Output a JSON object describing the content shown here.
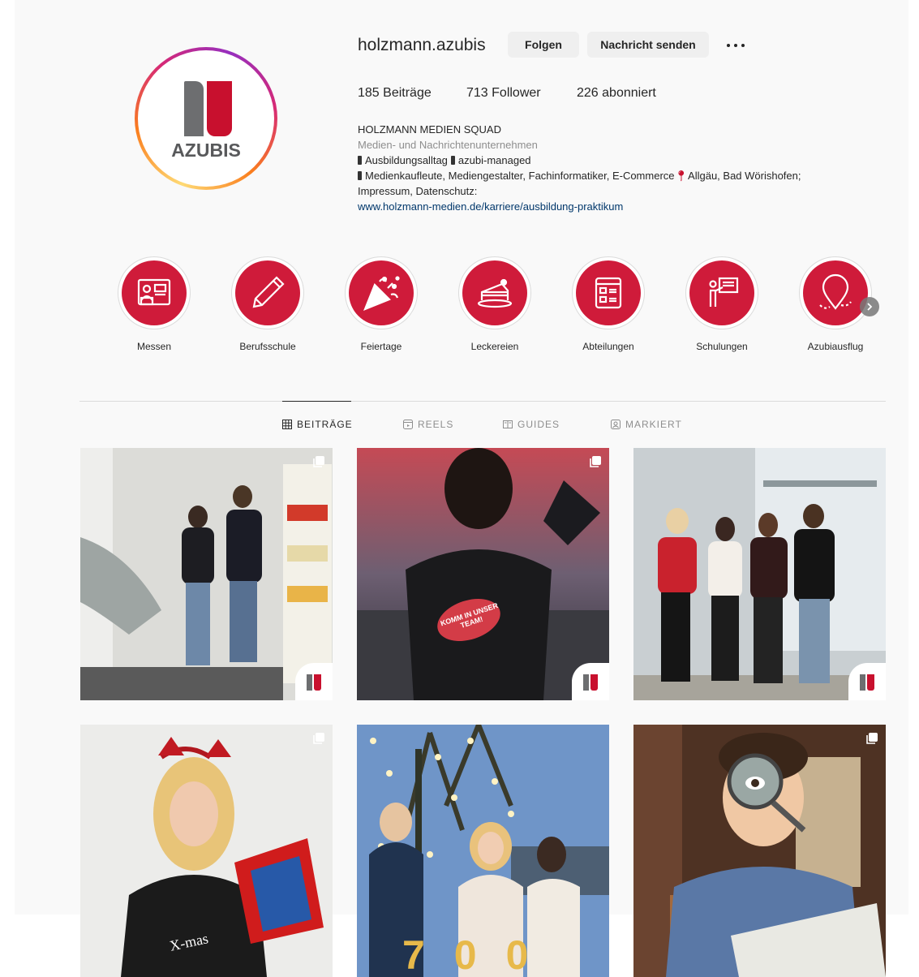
{
  "profile": {
    "username": "holzmann.azubis",
    "avatar_text": "AZUBIS",
    "follow_label": "Folgen",
    "message_label": "Nachricht senden",
    "stats": {
      "posts": "185 Beiträge",
      "followers": "713 Follower",
      "following": "226 abonniert"
    },
    "bio": {
      "name": "HOLZMANN MEDIEN SQUAD",
      "category": "Medien- und Nachrichtenunternehmen",
      "line1_a": "Ausbildungsalltag",
      "line1_b": "azubi-managed",
      "line2_a": "Medienkaufleute, Mediengestalter, Fachinformatiker, E-Commerce",
      "line2_b": "Allgäu, Bad Wörishofen;",
      "line3": "Impressum, Datenschutz:",
      "link": "www.holzmann-medien.de/karriere/ausbildung-praktikum"
    }
  },
  "highlights": [
    {
      "label": "Messen",
      "icon": "booth-icon"
    },
    {
      "label": "Berufsschule",
      "icon": "pencil-icon"
    },
    {
      "label": "Feiertage",
      "icon": "party-popper-icon"
    },
    {
      "label": "Leckereien",
      "icon": "cake-icon"
    },
    {
      "label": "Abteilungen",
      "icon": "document-list-icon"
    },
    {
      "label": "Schulungen",
      "icon": "presenter-icon"
    },
    {
      "label": "Azubiausflug",
      "icon": "map-pin-icon"
    }
  ],
  "tabs": [
    {
      "label": "BEITRÄGE",
      "icon": "grid-icon",
      "active": true
    },
    {
      "label": "REELS",
      "icon": "reels-icon",
      "active": false
    },
    {
      "label": "GUIDES",
      "icon": "guides-icon",
      "active": false
    },
    {
      "label": "MARKIERT",
      "icon": "tagged-icon",
      "active": false
    }
  ],
  "posts": [
    {
      "type": "carousel"
    },
    {
      "type": "carousel",
      "shirt_text": "KOMM IN UNSER TEAM!"
    },
    {
      "type": "image"
    },
    {
      "type": "carousel",
      "sweater_text": "X-mas"
    },
    {
      "type": "image",
      "number_text": "700"
    },
    {
      "type": "carousel"
    }
  ],
  "colors": {
    "brand_red": "#c8102e",
    "brand_grey": "#6d6e70",
    "highlight_red": "#cf1b3a",
    "link": "#00376b"
  }
}
